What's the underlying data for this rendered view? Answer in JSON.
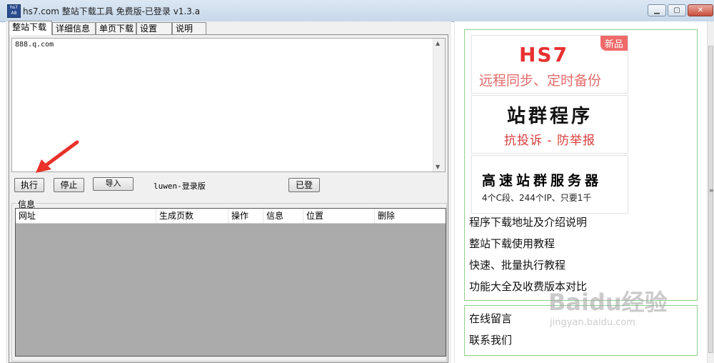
{
  "window": {
    "icon_text": "hs7 A8",
    "title": "hs7.com 整站下载工具 免费版-已登录  v1.3.a",
    "controls": [
      "minimize",
      "maximize",
      "close"
    ]
  },
  "tabs": [
    {
      "label": "整站下载",
      "active": true
    },
    {
      "label": "详细信息",
      "active": false
    },
    {
      "label": "单页下载",
      "active": false
    },
    {
      "label": "设置",
      "active": false
    },
    {
      "label": "说明",
      "active": false
    }
  ],
  "url_input": {
    "value": "888.q.com"
  },
  "buttons": {
    "execute": "执行",
    "stop": "停止",
    "import": "导入",
    "logged_in": "已登"
  },
  "login_label": "luwen-登录版",
  "info_group": {
    "title": "信息",
    "columns": [
      "网址",
      "生成页数",
      "操作",
      "信息",
      "位置",
      "删除"
    ]
  },
  "ads": [
    {
      "logo": "HS7",
      "badge": "新品",
      "subtitle": "远程同步、定时备份"
    },
    {
      "title": "站群程序",
      "subtitle": "抗投诉 - 防举报"
    },
    {
      "title": "高速站群服务器",
      "subtitle": "4个C段、244个IP、只要1千"
    }
  ],
  "links": [
    "程序下载地址及介绍说明",
    "整站下载使用教程",
    "快速、批量执行教程",
    "功能大全及收费版本对比"
  ],
  "links2": [
    "在线留言",
    "联系我们"
  ],
  "watermark": {
    "main": "Baidu经验",
    "sub": "jingyan.baidu.com"
  },
  "colors": {
    "list_bg": "#ababab",
    "panel_border": "#8fd08f",
    "arrow": "#e8322a"
  }
}
